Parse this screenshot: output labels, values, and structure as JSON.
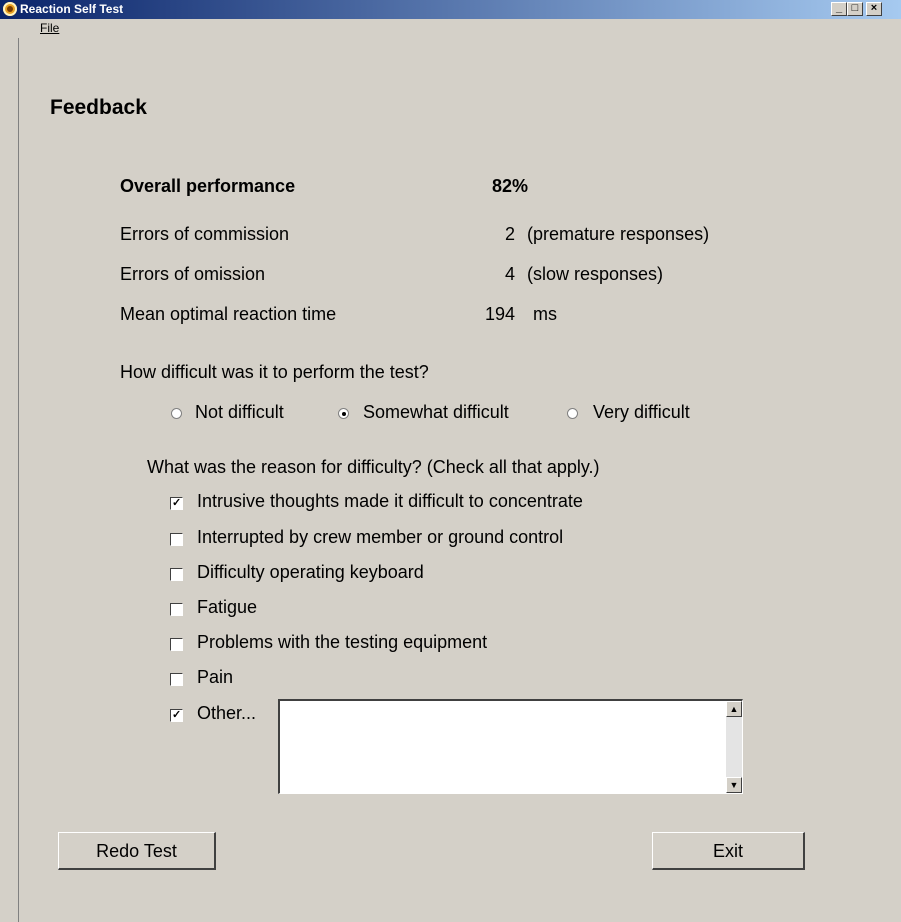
{
  "window": {
    "title": "Reaction Self Test"
  },
  "menu": {
    "file": "File"
  },
  "heading": "Feedback",
  "results": [
    {
      "label": "Overall performance",
      "value": "82%",
      "note": ""
    },
    {
      "label": "Errors of commission",
      "value": "2",
      "note": "(premature responses)"
    },
    {
      "label": "Errors of omission",
      "value": "4",
      "note": "(slow responses)"
    },
    {
      "label": "Mean optimal reaction time",
      "value": "194",
      "note": "ms"
    }
  ],
  "difficulty": {
    "question": "How difficult was it to perform the test?",
    "options": [
      "Not difficult",
      "Somewhat difficult",
      "Very difficult"
    ],
    "selected": "Somewhat difficult"
  },
  "reasons": {
    "question": "What was the reason for difficulty? (Check all that apply.)",
    "items": [
      {
        "label": "Intrusive thoughts made it difficult to concentrate",
        "checked": true
      },
      {
        "label": "Interrupted by crew member or ground control",
        "checked": false
      },
      {
        "label": "Difficulty operating keyboard",
        "checked": false
      },
      {
        "label": "Fatigue",
        "checked": false
      },
      {
        "label": "Problems with the testing equipment",
        "checked": false
      },
      {
        "label": "Pain",
        "checked": false
      },
      {
        "label": "Other...",
        "checked": true
      }
    ],
    "other_text": ""
  },
  "buttons": {
    "redo": "Redo Test",
    "exit": "Exit"
  }
}
